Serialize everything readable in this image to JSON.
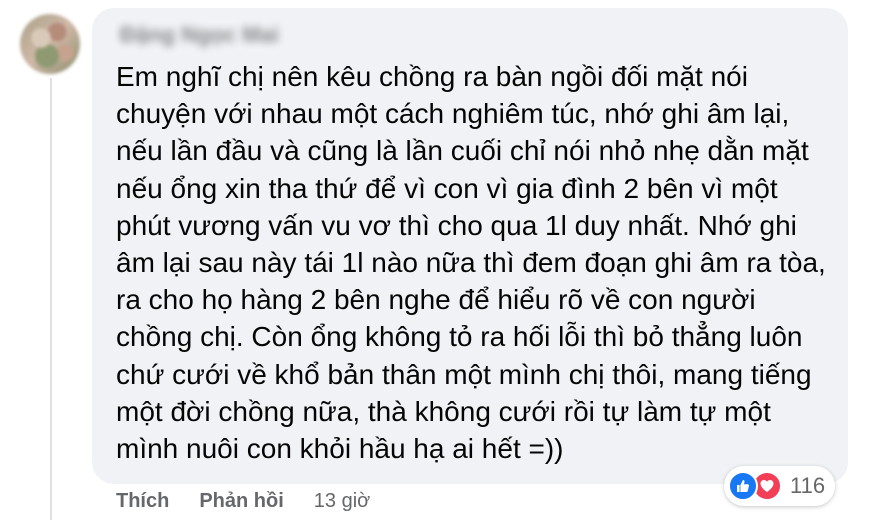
{
  "comment": {
    "author": "Đặng Ngọc Mai",
    "lines": [
      "Em nghĩ chị nên kêu chồng ra bàn ngồi đối mặt nói",
      "chuyện với nhau một cách nghiêm túc, nhớ ghi âm lại,",
      "nếu lần đầu và cũng là lần cuối chỉ nói nhỏ nhẹ dằn mặt",
      "nếu ổng xin tha thứ để vì con vì gia đình 2 bên vì một",
      "phút vương vấn vu vơ thì cho qua 1l duy nhất. Nhớ ghi",
      "âm lại sau này tái 1l nào nữa thì đem đoạn ghi âm ra tòa,",
      "ra cho họ hàng 2 bên nghe để hiểu rõ về con người",
      "chồng chị. Còn ổng không tỏ ra hối lỗi thì bỏ thẳng luôn",
      "chứ cưới về khổ bản thân một mình chị thôi, mang tiếng",
      "một đời chồng nữa, thà không cưới rồi tự làm tự một",
      "mình nuôi con khỏi hầu hạ ai hết =))"
    ]
  },
  "reactions": {
    "icons": [
      "like-icon",
      "love-icon"
    ],
    "count": "116",
    "like_color": "#1877f2",
    "love_color": "#f33e58"
  },
  "actions": {
    "like_label": "Thích",
    "reply_label": "Phản hồi",
    "time": "13 giờ"
  },
  "colors": {
    "bubble_bg": "#f0f2f5",
    "text": "#050505",
    "secondary_text": "#65676b"
  }
}
